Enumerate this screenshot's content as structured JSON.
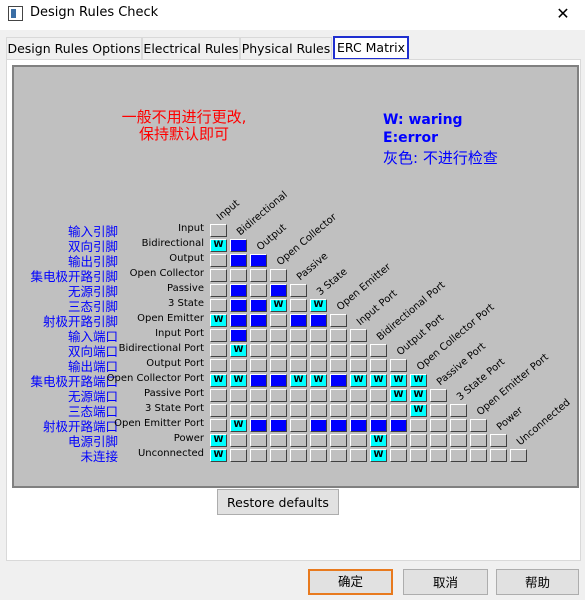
{
  "window": {
    "title": "Design Rules Check",
    "close_glyph": "✕"
  },
  "tabs": [
    {
      "label": "Design Rules Options"
    },
    {
      "label": "Electrical Rules"
    },
    {
      "label": "Physical Rules"
    },
    {
      "label": "ERC Matrix"
    }
  ],
  "notes": {
    "red_line1": "一般不用进行更改,",
    "red_line2": "保持默认即可",
    "w_note": "W:  waring",
    "e_note": "E:error",
    "gray_note": "灰色: 不进行检查"
  },
  "matrix": {
    "row_labels": [
      "Input",
      "Bidirectional",
      "Output",
      "Open Collector",
      "Passive",
      "3 State",
      "Open Emitter",
      "Input Port",
      "Bidirectional Port",
      "Output Port",
      "Open Collector Port",
      "Passive Port",
      "3 State Port",
      "Open Emitter Port",
      "Power",
      "Unconnected"
    ],
    "col_labels": [
      "Input",
      "Bidirectional",
      "Output",
      "Open Collector",
      "Passive",
      "3 State",
      "Open Emitter",
      "Input Port",
      "Bidirectional Port",
      "Output Port",
      "Open Collector Port",
      "Passive Port",
      "3 State Port",
      "Open Emitter Port",
      "Power",
      "Unconnected"
    ],
    "cn_labels": [
      "输入引脚",
      "双向引脚",
      "输出引脚",
      "集电极开路引脚",
      "无源引脚",
      "三态引脚",
      "射极开路引脚",
      "输入端口",
      "双向端口",
      "输出端口",
      "集电极开路端口",
      "无源端口",
      "三态端口",
      "射极开路端口",
      "电源引脚",
      "未连接"
    ],
    "cells": [
      "",
      "..",
      "WEE",
      ".EE.",
      ".....",
      ".E.E..",
      ".EEW.W.",
      "WEE.EE..",
      ".E.......",
      ".W........",
      "...........",
      "WWEEWWEWWWW.",
      ".........WW..",
      "..........W...",
      ".WEE.EEEEE.....",
      "W.......W.......",
      "W.......W......."
    ]
  },
  "buttons": {
    "restore": "Restore defaults",
    "ok": "确定",
    "cancel": "取消",
    "help": "帮助"
  }
}
